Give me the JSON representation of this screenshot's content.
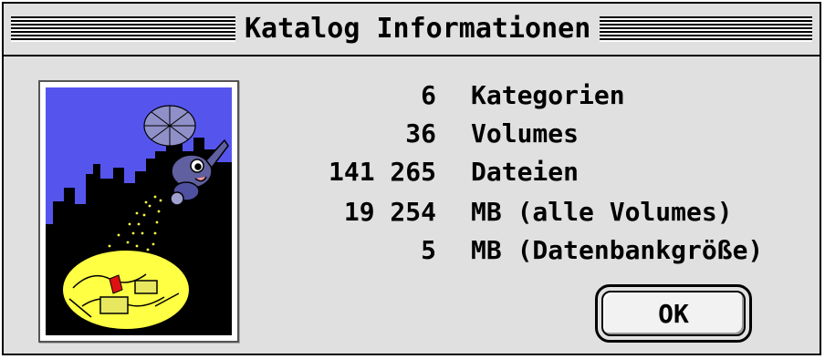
{
  "window": {
    "title": "Katalog Informationen"
  },
  "stats": [
    {
      "value": "6",
      "label": "Kategorien"
    },
    {
      "value": "36",
      "label": "Volumes"
    },
    {
      "value": "141 265",
      "label": "Dateien"
    },
    {
      "value": "19 254",
      "label": "MB (alle Volumes)"
    },
    {
      "value": "5",
      "label": "MB (Datenbankgröße)"
    }
  ],
  "buttons": {
    "ok_label": "OK"
  },
  "colors": {
    "window_bg": "#e0e0e0",
    "illustration_sky": "#5555ee",
    "illustration_city": "#000000",
    "illustration_light": "#ffff44",
    "illustration_heli": "#6060a0"
  }
}
